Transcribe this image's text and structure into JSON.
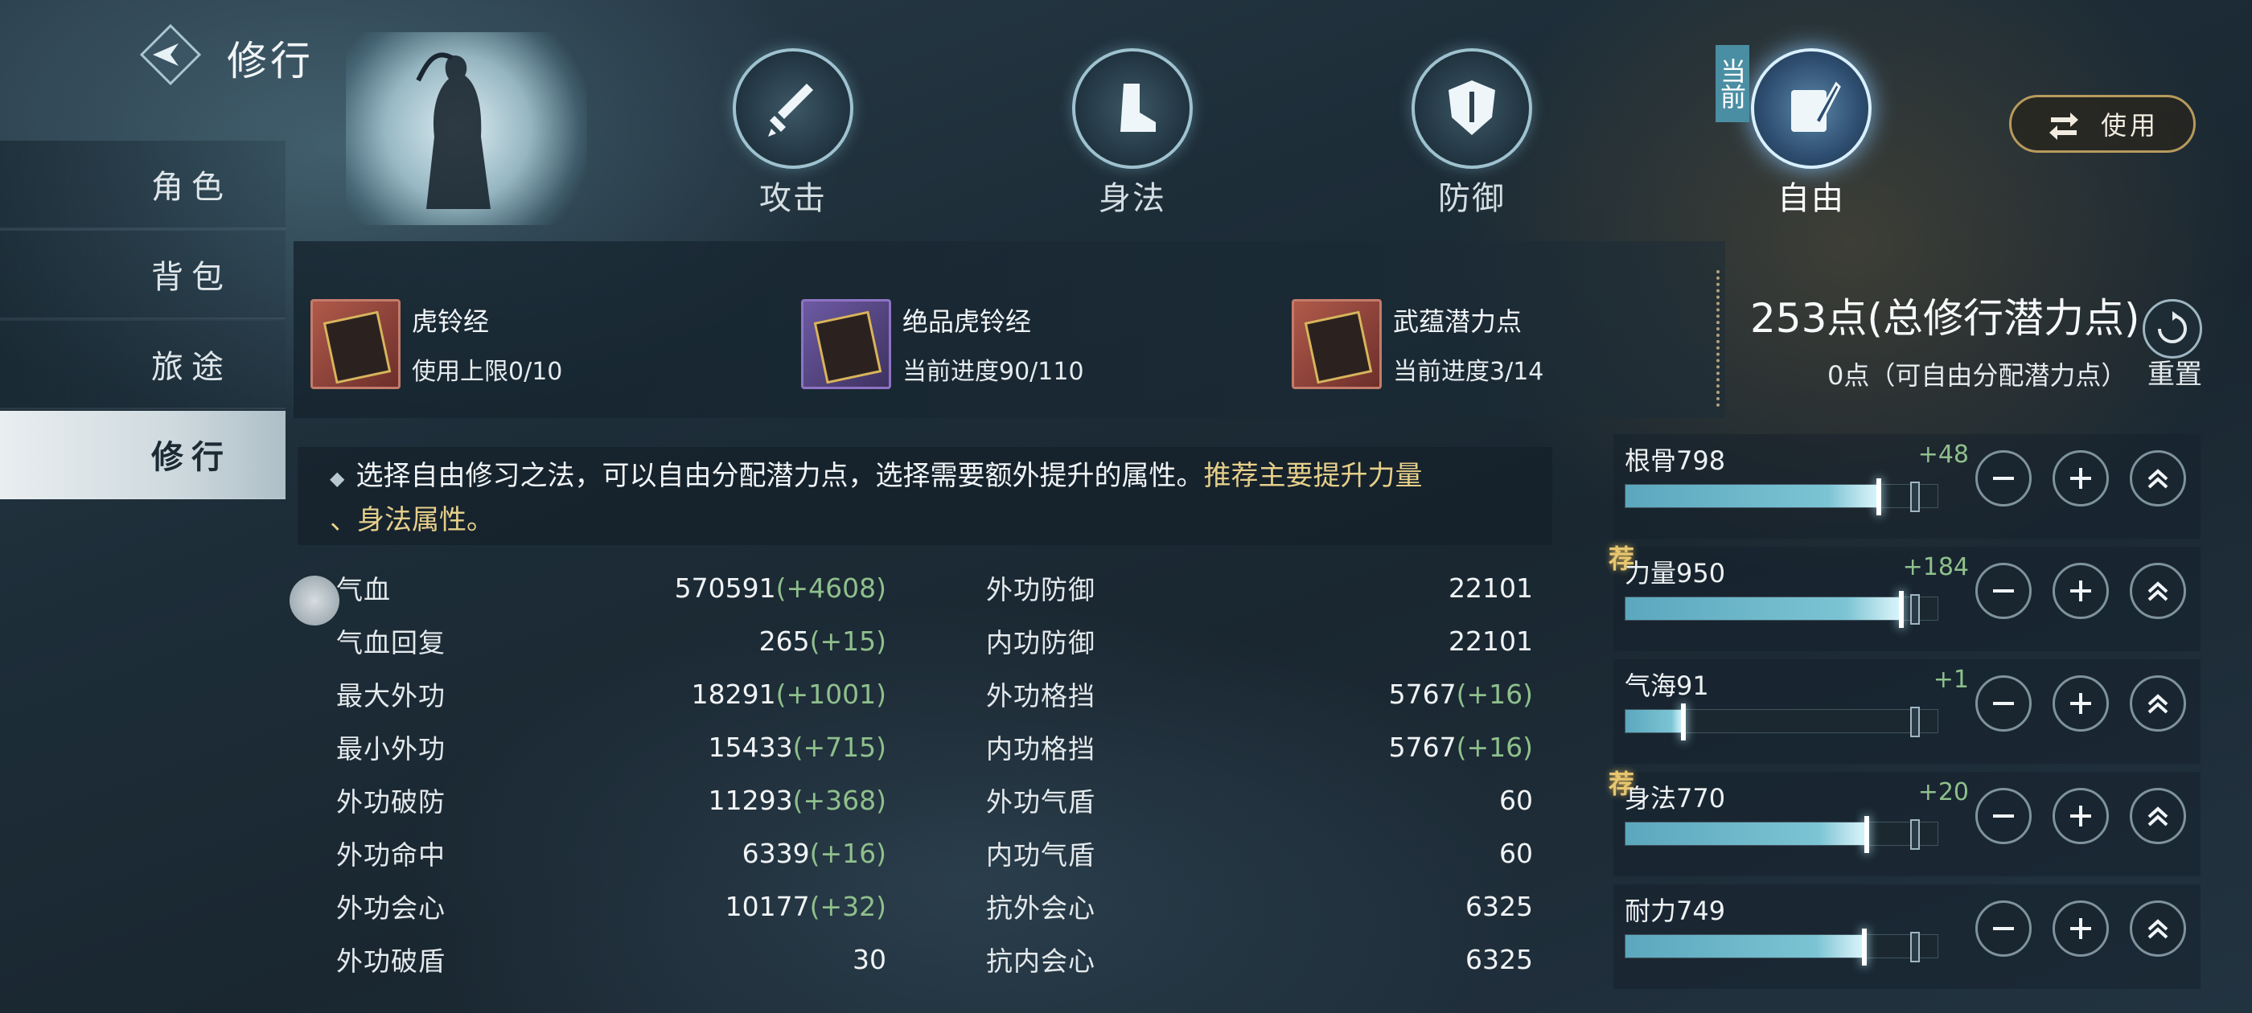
{
  "header": {
    "title": "修行"
  },
  "sidebar": {
    "items": [
      {
        "label": "角色",
        "active": false
      },
      {
        "label": "背包",
        "active": false
      },
      {
        "label": "旅途",
        "active": false
      },
      {
        "label": "修行",
        "active": true
      }
    ]
  },
  "tabs": [
    {
      "label": "攻击",
      "icon": "sword-icon"
    },
    {
      "label": "身法",
      "icon": "boot-icon"
    },
    {
      "label": "防御",
      "icon": "shield-icon"
    },
    {
      "label": "自由",
      "icon": "scroll-quill-icon",
      "current": true
    }
  ],
  "current_tag": "当前",
  "use_button": {
    "label": "使用",
    "icon": "swap-arrows-icon"
  },
  "items": [
    {
      "name": "虎铃经",
      "sub": "使用上限0/10"
    },
    {
      "name": "绝品虎铃经",
      "sub": "当前进度90/110"
    },
    {
      "name": "武蕴潜力点",
      "sub": "当前进度3/14"
    }
  ],
  "points": {
    "total": "253点(总修行潜力点)",
    "free": "0点（可自由分配潜力点）",
    "reset_label": "重置"
  },
  "tip": {
    "text": "选择自由修习之法，可以自由分配潜力点，选择需要额外提升的属性。",
    "highlight1": "推荐主要提升力量",
    "highlight2": "、身法属性。"
  },
  "stats_left": [
    {
      "name": "气血",
      "value": "570591",
      "bonus": "(+4608)"
    },
    {
      "name": "气血回复",
      "value": "265",
      "bonus": "(+15)"
    },
    {
      "name": "最大外功",
      "value": "18291",
      "bonus": "(+1001)"
    },
    {
      "name": "最小外功",
      "value": "15433",
      "bonus": "(+715)"
    },
    {
      "name": "外功破防",
      "value": "11293",
      "bonus": "(+368)"
    },
    {
      "name": "外功命中",
      "value": "6339",
      "bonus": "(+16)"
    },
    {
      "name": "外功会心",
      "value": "10177",
      "bonus": "(+32)"
    },
    {
      "name": "外功破盾",
      "value": "30",
      "bonus": ""
    }
  ],
  "stats_right": [
    {
      "name": "外功防御",
      "value": "22101",
      "bonus": ""
    },
    {
      "name": "内功防御",
      "value": "22101",
      "bonus": ""
    },
    {
      "name": "外功格挡",
      "value": "5767",
      "bonus": "(+16)"
    },
    {
      "name": "内功格挡",
      "value": "5767",
      "bonus": "(+16)"
    },
    {
      "name": "外功气盾",
      "value": "60",
      "bonus": ""
    },
    {
      "name": "内功气盾",
      "value": "60",
      "bonus": ""
    },
    {
      "name": "抗外会心",
      "value": "6325",
      "bonus": ""
    },
    {
      "name": "抗内会心",
      "value": "6325",
      "bonus": ""
    }
  ],
  "attributes": [
    {
      "label": "根骨798",
      "bonus": "+48",
      "recommended": false,
      "fill": 0.88,
      "rec_label": ""
    },
    {
      "label": "力量950",
      "bonus": "+184",
      "recommended": true,
      "fill": 0.96,
      "rec_label": "荐"
    },
    {
      "label": "气海91",
      "bonus": "+1",
      "recommended": false,
      "fill": 0.2,
      "rec_label": ""
    },
    {
      "label": "身法770",
      "bonus": "+20",
      "recommended": true,
      "fill": 0.84,
      "rec_label": "荐"
    },
    {
      "label": "耐力749",
      "bonus": "",
      "recommended": false,
      "fill": 0.83,
      "rec_label": ""
    }
  ],
  "colors": {
    "bonus_green": "#8fc08c",
    "highlight_gold": "#e6cf8a",
    "accent_blue": "#7cc4d4"
  }
}
